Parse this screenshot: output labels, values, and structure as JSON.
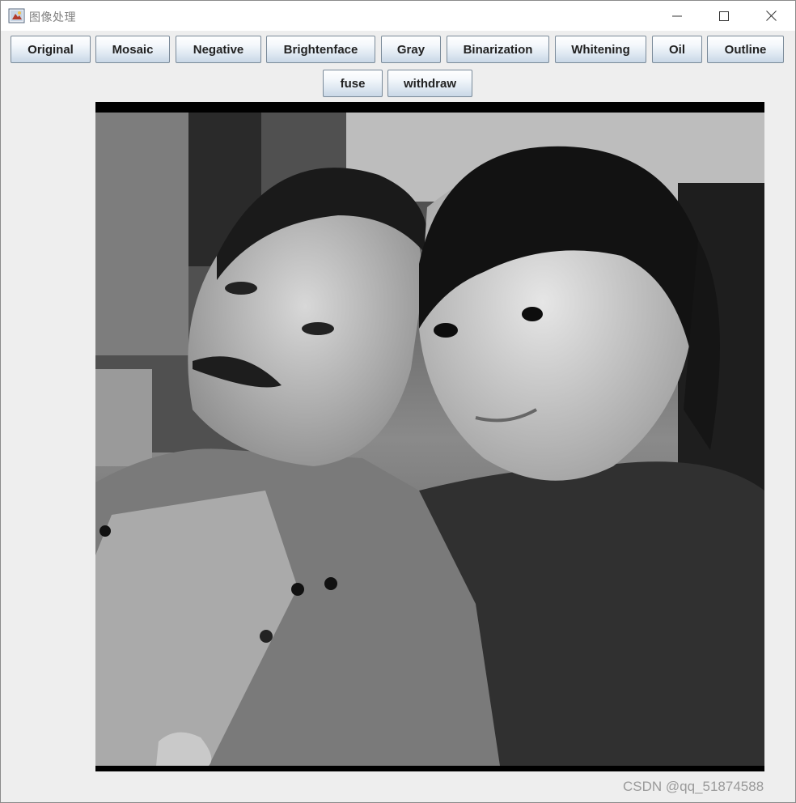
{
  "window": {
    "title": "图像处理",
    "minimize_icon": "minimize-icon",
    "maximize_icon": "maximize-icon",
    "close_icon": "close-icon"
  },
  "toolbar": {
    "buttons": [
      "Original",
      "Mosaic",
      "Negative",
      "Brightenface",
      "Gray",
      "Binarization",
      "Whitening",
      "Oil",
      "Outline",
      "fuse",
      "withdraw"
    ]
  },
  "image": {
    "description_icon": "grayscale-photo"
  },
  "watermark": "CSDN @qq_51874588"
}
